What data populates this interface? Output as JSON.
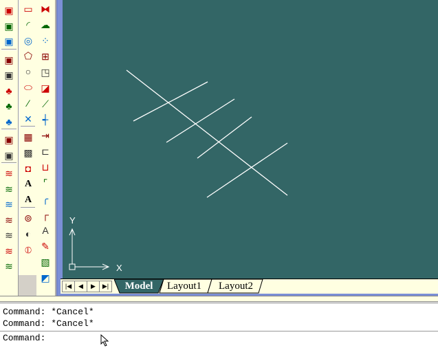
{
  "toolbars": {
    "col1": [
      "view-icon",
      "properties-icon",
      "ucs-icon",
      "render-icon",
      "landscape-icon",
      "tree-icon",
      "tree-edit-icon",
      "tree-library-icon",
      "scene-icon",
      "materials-icon",
      "shade-1-icon",
      "shade-2-icon",
      "shade-3-icon",
      "shade-4-icon",
      "shade-5-icon",
      "shade-6-icon",
      "shade-7-icon"
    ],
    "col2": [
      "rectangle-icon",
      "arc-icon",
      "circle-icon",
      "polygon-icon",
      "circle-3p-icon",
      "ellipse-icon",
      "divide-icon",
      "point-icon",
      "hatch-icon",
      "gradient-hatch-icon",
      "region-icon",
      "text-icon",
      "mtext-icon",
      "union-icon",
      "subtract-icon",
      "intersect-icon"
    ],
    "col3": [
      "mirror-icon",
      "revcloud-icon",
      "array-icon",
      "array-grid-icon",
      "scale-icon",
      "stretch-icon",
      "break-icon",
      "trim-icon",
      "extend-icon",
      "break-at-point-icon",
      "join-icon",
      "chamfer-icon",
      "fillet-icon",
      "corner-icon",
      "edit-text-icon",
      "edit-polyline-icon",
      "edit-hatch-icon",
      "draw-order-icon"
    ]
  },
  "canvas": {
    "background": "#336666",
    "line_color": "#ffffff",
    "ucs": {
      "x_label": "X",
      "y_label": "Y"
    }
  },
  "tabs": {
    "items": [
      "Model",
      "Layout1",
      "Layout2"
    ],
    "active": "Model"
  },
  "command": {
    "history": [
      "Command: *Cancel*",
      "Command: *Cancel*"
    ],
    "prompt": "Command:"
  }
}
